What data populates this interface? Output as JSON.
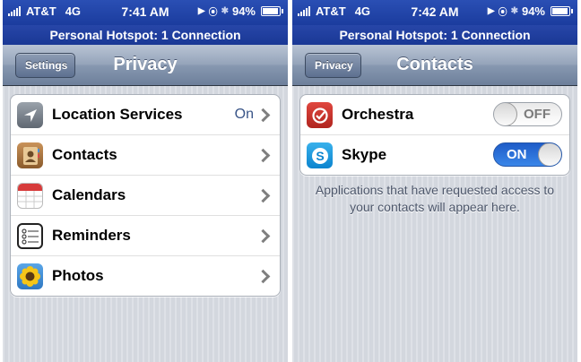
{
  "left_screen": {
    "status_bar": {
      "carrier": "AT&T",
      "network": "4G",
      "time": "7:41 AM",
      "battery": "94%"
    },
    "hotspot_banner": "Personal Hotspot: 1 Connection",
    "nav": {
      "back_label": "Settings",
      "title": "Privacy"
    },
    "rows": [
      {
        "label": "Location Services",
        "value": "On",
        "icon": "location-arrow-icon"
      },
      {
        "label": "Contacts",
        "icon": "contacts-book-icon"
      },
      {
        "label": "Calendars",
        "icon": "calendar-icon"
      },
      {
        "label": "Reminders",
        "icon": "reminders-list-icon"
      },
      {
        "label": "Photos",
        "icon": "sunflower-photos-icon"
      }
    ]
  },
  "right_screen": {
    "status_bar": {
      "carrier": "AT&T",
      "network": "4G",
      "time": "7:42 AM",
      "battery": "94%"
    },
    "hotspot_banner": "Personal Hotspot: 1 Connection",
    "nav": {
      "back_label": "Privacy",
      "title": "Contacts"
    },
    "apps": [
      {
        "label": "Orchestra",
        "toggle": "OFF",
        "icon": "orchestra-app-icon"
      },
      {
        "label": "Skype",
        "toggle": "ON",
        "icon": "skype-app-icon"
      }
    ],
    "footer": "Applications that have requested access to your contacts will appear here."
  },
  "colors": {
    "status_blue": "#1b3c9e",
    "toggle_on_blue": "#2a6fdc",
    "value_blue": "#385487"
  },
  "battery_level": 0.94
}
